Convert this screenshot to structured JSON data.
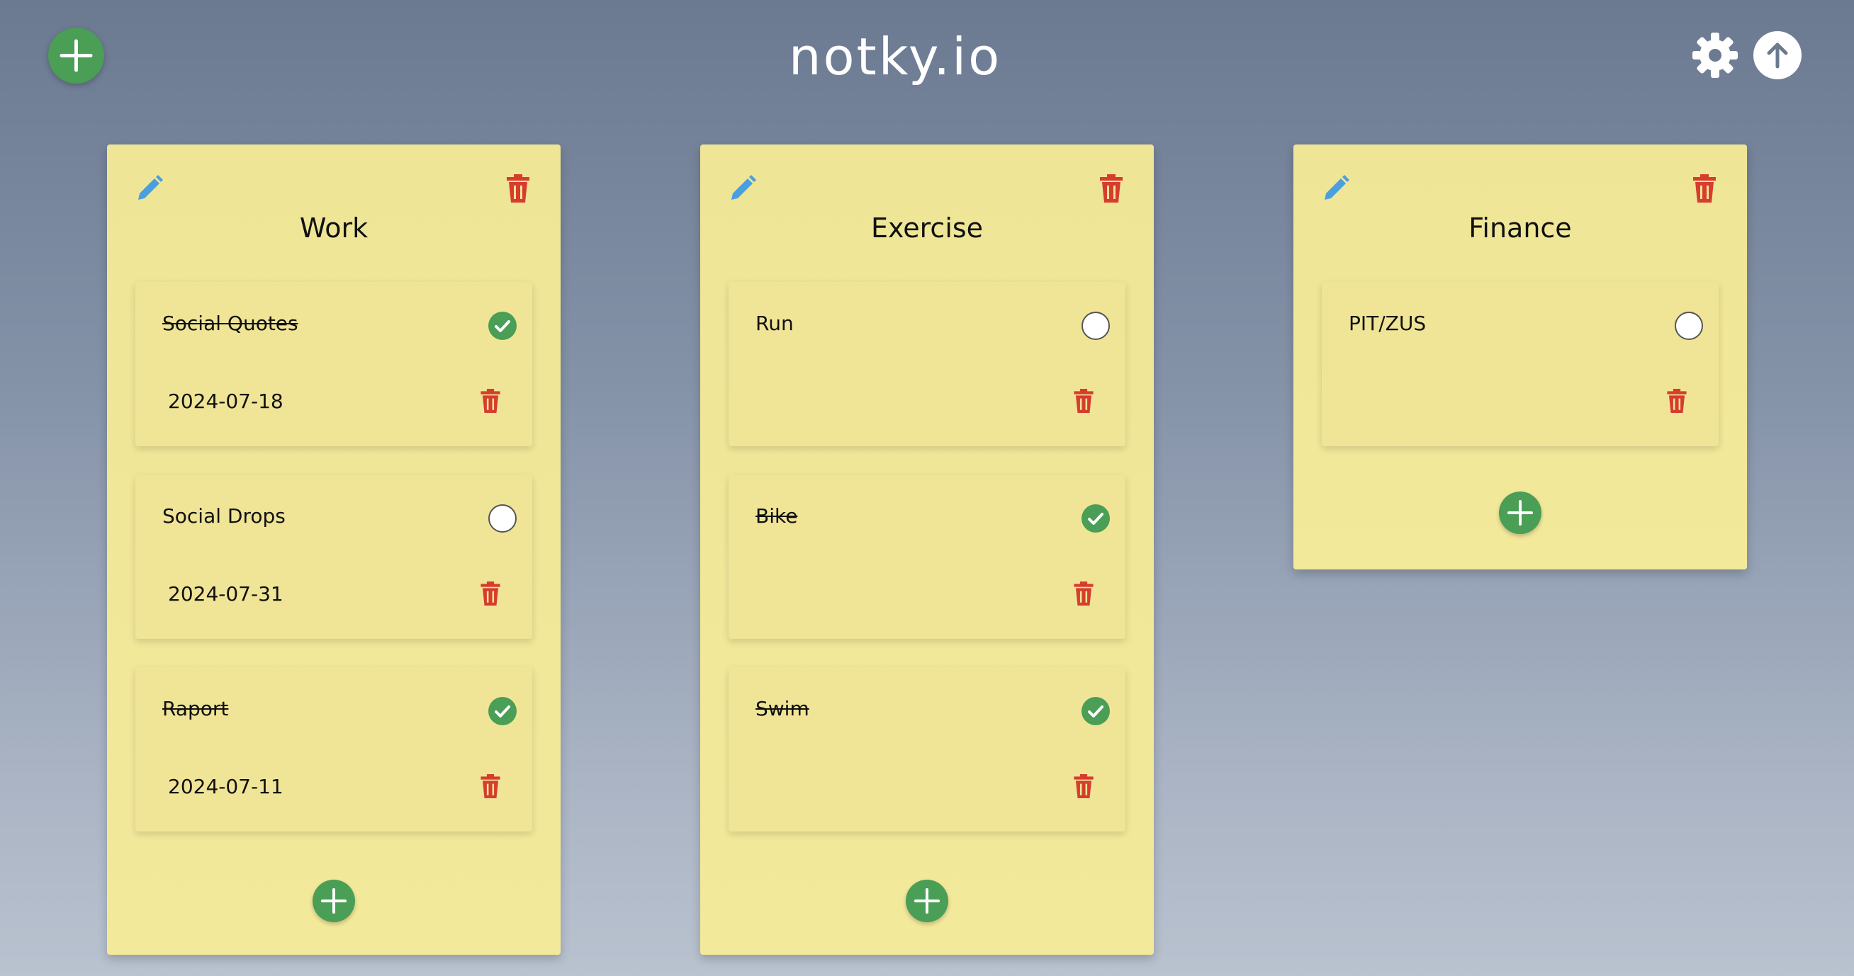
{
  "app": {
    "title": "notky.io",
    "accent_green": "#4a9e55",
    "delete_red": "#d63d2e",
    "edit_blue": "#4a9fe0"
  },
  "header": {
    "add_board_icon": "plus-icon",
    "settings_icon": "gear-icon",
    "upload_icon": "arrow-up-icon"
  },
  "boards": [
    {
      "title": "Work",
      "tasks": [
        {
          "label": "Social Quotes",
          "done": true,
          "date": "2024-07-18"
        },
        {
          "label": "Social Drops",
          "done": false,
          "date": "2024-07-31"
        },
        {
          "label": "Raport",
          "done": true,
          "date": "2024-07-11"
        }
      ]
    },
    {
      "title": "Exercise",
      "tasks": [
        {
          "label": "Run",
          "done": false,
          "date": ""
        },
        {
          "label": "Bike",
          "done": true,
          "date": ""
        },
        {
          "label": "Swim",
          "done": true,
          "date": ""
        }
      ]
    },
    {
      "title": "Finance",
      "tasks": [
        {
          "label": "PIT/ZUS",
          "done": false,
          "date": ""
        }
      ]
    }
  ]
}
